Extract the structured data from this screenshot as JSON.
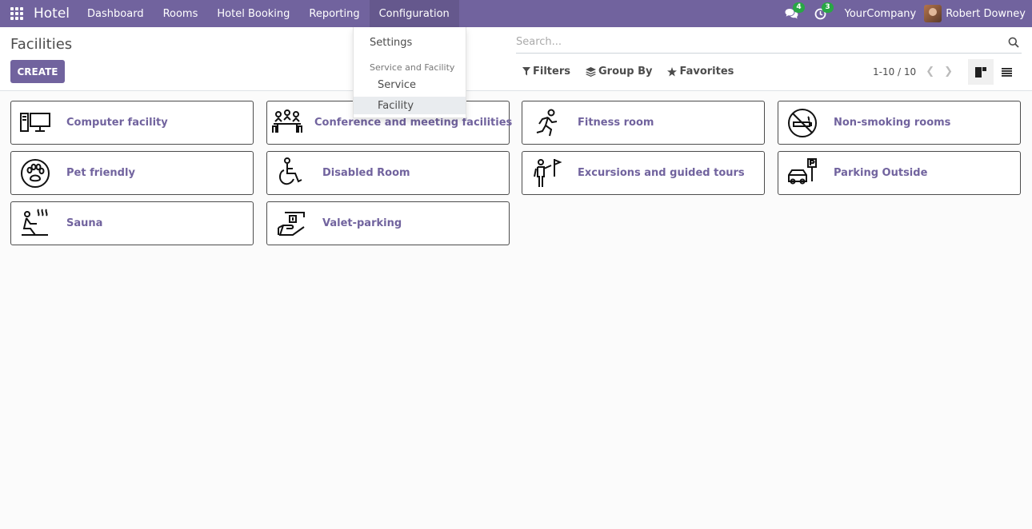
{
  "navbar": {
    "brand": "Hotel",
    "menu": [
      "Dashboard",
      "Rooms",
      "Hotel Booking",
      "Reporting",
      "Configuration"
    ],
    "messages_badge": "4",
    "activities_badge": "3",
    "company": "YourCompany",
    "user": "Robert Downey"
  },
  "control_panel": {
    "title": "Facilities",
    "create_label": "CREATE",
    "search_placeholder": "Search...",
    "filters_label": "Filters",
    "group_by_label": "Group By",
    "favorites_label": "Favorites",
    "pager": "1-10 / 10"
  },
  "dropdown": {
    "settings": "Settings",
    "section_header": "Service and Facility",
    "service": "Service",
    "facility": "Facility"
  },
  "facilities": [
    {
      "name": "Computer facility",
      "icon": "computer-icon"
    },
    {
      "name": "Conference and meeting facilities",
      "icon": "meeting-icon"
    },
    {
      "name": "Fitness room",
      "icon": "running-icon"
    },
    {
      "name": "Non-smoking rooms",
      "icon": "no-smoking-icon"
    },
    {
      "name": "Pet friendly",
      "icon": "paw-icon"
    },
    {
      "name": "Disabled Room",
      "icon": "wheelchair-icon"
    },
    {
      "name": "Excursions and guided tours",
      "icon": "guide-icon"
    },
    {
      "name": "Parking Outside",
      "icon": "parking-icon"
    },
    {
      "name": "Sauna",
      "icon": "sauna-icon"
    },
    {
      "name": "Valet-parking",
      "icon": "valet-icon"
    }
  ],
  "colors": {
    "brand": "#71639e",
    "badge": "#28a745"
  }
}
